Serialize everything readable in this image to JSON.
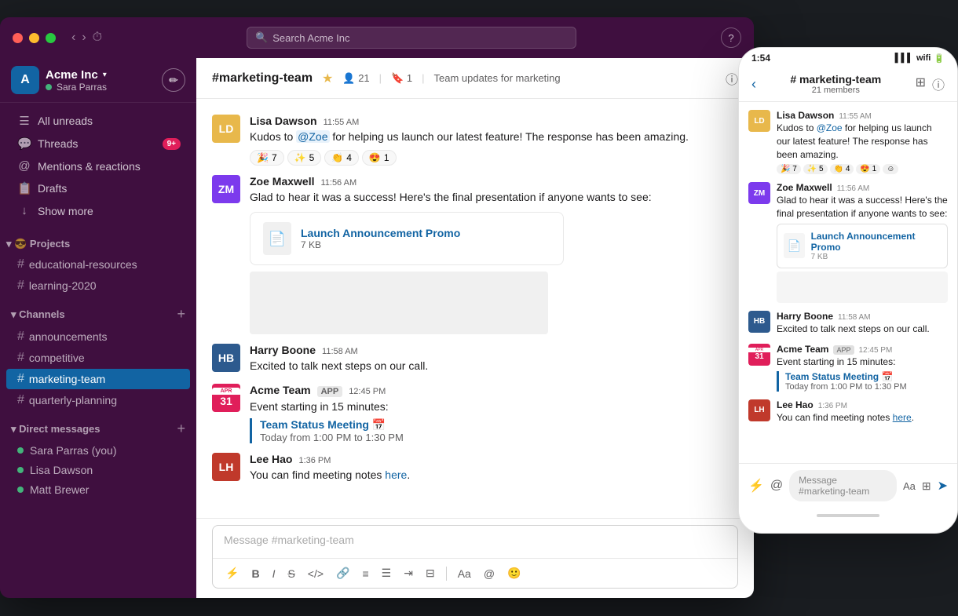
{
  "app": {
    "title": "Acme Inc",
    "search_placeholder": "Search Acme Inc"
  },
  "titlebar": {
    "traffic_lights": [
      "red",
      "yellow",
      "green"
    ],
    "help_label": "?"
  },
  "sidebar": {
    "workspace": {
      "name": "Acme Inc",
      "chevron": "▾",
      "user": "Sara Parras"
    },
    "nav_items": [
      {
        "id": "all-unreads",
        "icon": "≡",
        "label": "All unreads"
      },
      {
        "id": "threads",
        "icon": "💬",
        "label": "Threads",
        "badge": "9+"
      },
      {
        "id": "mentions",
        "icon": "@",
        "label": "Mentions & reactions"
      },
      {
        "id": "drafts",
        "icon": "📋",
        "label": "Drafts"
      },
      {
        "id": "show-more",
        "icon": "↓",
        "label": "Show more"
      }
    ],
    "projects_section": {
      "label": "Projects",
      "emoji": "😎",
      "channels": [
        "educational-resources",
        "learning-2020"
      ]
    },
    "channels_section": {
      "label": "Channels",
      "channels": [
        "announcements",
        "competitive",
        "marketing-team",
        "quarterly-planning"
      ]
    },
    "dm_section": {
      "label": "Direct messages",
      "users": [
        {
          "name": "Sara Parras (you)",
          "status": "online"
        },
        {
          "name": "Lisa Dawson",
          "status": "online"
        },
        {
          "name": "Matt Brewer",
          "status": "online"
        }
      ]
    }
  },
  "channel": {
    "name": "#marketing-team",
    "star": "★",
    "members": "21",
    "bookmarks": "1",
    "description": "Team updates for marketing"
  },
  "messages": [
    {
      "id": "msg1",
      "author": "Lisa Dawson",
      "time": "11:55 AM",
      "text_before": "Kudos to ",
      "mention": "@Zoe",
      "text_after": " for helping us launch our latest feature! The response has been amazing.",
      "reactions": [
        {
          "emoji": "🎉",
          "count": "7"
        },
        {
          "emoji": "✨",
          "count": "5"
        },
        {
          "emoji": "👏",
          "count": "4"
        },
        {
          "emoji": "😍",
          "count": "1"
        }
      ],
      "avatar_color": "#e8b84b"
    },
    {
      "id": "msg2",
      "author": "Zoe Maxwell",
      "time": "11:56 AM",
      "text": "Glad to hear it was a success! Here's the final presentation if anyone wants to see:",
      "attachment": {
        "name": "Launch Announcement Promo",
        "size": "7 KB"
      },
      "avatar_color": "#7c3aed"
    },
    {
      "id": "msg3",
      "author": "Harry Boone",
      "time": "11:58 AM",
      "text": "Excited to talk next steps on our call.",
      "avatar_color": "#2d5a8e"
    },
    {
      "id": "msg4",
      "author": "Acme Team",
      "app_label": "APP",
      "time": "12:45 PM",
      "text": "Event starting in 15 minutes:",
      "meeting": {
        "title": "Team Status Meeting 📅",
        "time": "Today from 1:00 PM to 1:30 PM"
      },
      "is_app": true,
      "avatar_color": "#e01e5a"
    },
    {
      "id": "msg5",
      "author": "Lee Hao",
      "time": "1:36 PM",
      "text_before": "You can find meeting notes ",
      "link_text": "here",
      "text_after": ".",
      "avatar_color": "#c0392b"
    }
  ],
  "input": {
    "placeholder": "Message #marketing-team"
  },
  "phone": {
    "time": "1:54",
    "channel": "# marketing-team",
    "members": "21 members",
    "input_placeholder": "Message #marketing-team",
    "messages": [
      {
        "author": "Lisa Dawson",
        "time": "11:55 AM",
        "text_before": "Kudos to ",
        "mention": "@Zoe",
        "text_after": " for helping us launch our latest feature! The response has been amazing.",
        "reactions": [
          "🎉 7",
          "✨ 5",
          "👏 4",
          "😍 1",
          "☺"
        ],
        "avatar_color": "#e8b84b"
      },
      {
        "author": "Zoe Maxwell",
        "time": "11:56 AM",
        "text": "Glad to hear it was a success! Here's the final presentation if anyone wants to see:",
        "attachment": {
          "name": "Launch Announcement Promo",
          "size": "7 KB"
        },
        "avatar_color": "#7c3aed"
      },
      {
        "author": "Harry Boone",
        "time": "11:58 AM",
        "text": "Excited to talk next steps on our call.",
        "avatar_color": "#2d5a8e"
      },
      {
        "author": "Acme Team",
        "time": "12:45 PM",
        "text": "Event starting in 15 minutes:",
        "meeting": {
          "title": "Team Status Meeting 📅",
          "time": "Today from 1:00 PM to 1:30 PM"
        },
        "is_app": true,
        "avatar_color": "#e01e5a"
      },
      {
        "author": "Lee Hao",
        "time": "1:36 PM",
        "text_before": "You can find meeting notes ",
        "link": "here",
        "avatar_color": "#c0392b"
      }
    ]
  }
}
